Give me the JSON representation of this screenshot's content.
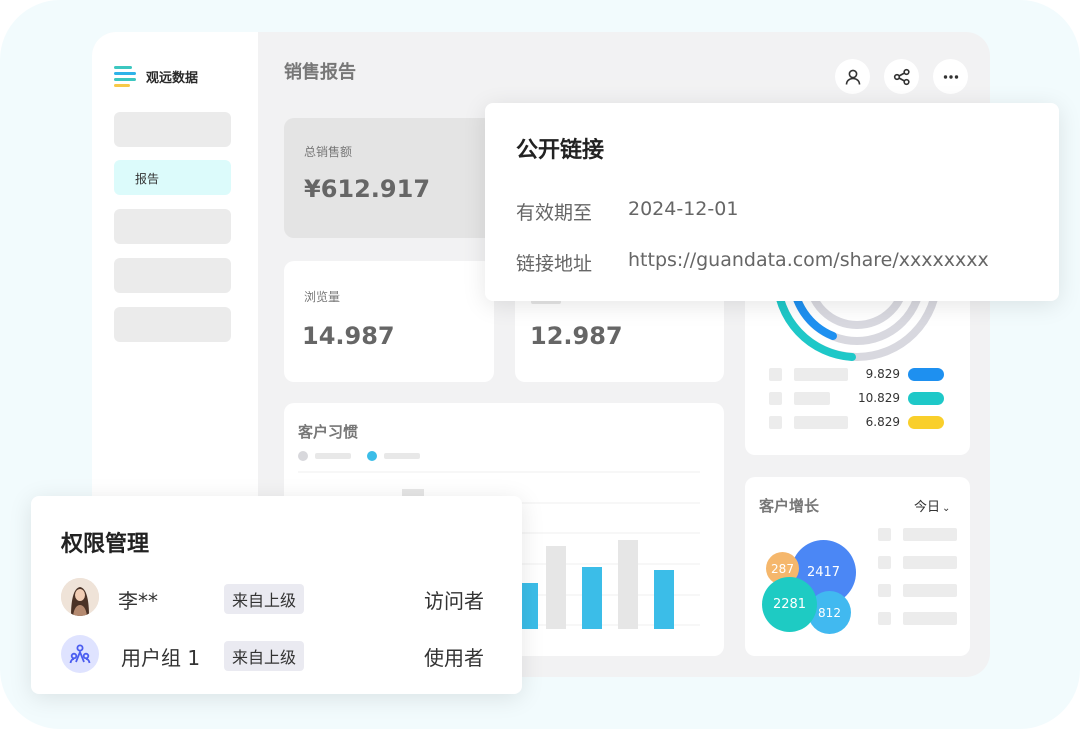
{
  "brand": {
    "name": "观远数据"
  },
  "sidebar": {
    "items": [
      {
        "label": ""
      },
      {
        "label": "报告"
      },
      {
        "label": ""
      },
      {
        "label": ""
      },
      {
        "label": ""
      }
    ]
  },
  "page": {
    "title": "销售报告"
  },
  "toolbar": {
    "icons": [
      "user-icon",
      "share-icon",
      "more-icon"
    ]
  },
  "kpis": {
    "total_sales": {
      "label": "总销售额",
      "value": "¥612.917"
    },
    "views": {
      "label": "浏览量",
      "value": "14.987"
    },
    "second": {
      "value": "12.987"
    }
  },
  "donut_legend": [
    {
      "value": "9.829",
      "color": "#1e90f0"
    },
    {
      "value": "10.829",
      "color": "#1ec8c8"
    },
    {
      "value": "6.829",
      "color": "#f9cf2b"
    }
  ],
  "habit": {
    "title": "客户习惯",
    "series_colors": [
      "#d8d8dc",
      "#3bbde8"
    ]
  },
  "growth": {
    "title": "客户增长",
    "period": "今日",
    "bubbles": [
      "287",
      "2417",
      "2281",
      "812"
    ]
  },
  "share_popup": {
    "title": "公开链接",
    "expiry_label": "有效期至",
    "expiry_value": "2024-12-01",
    "link_label": "链接地址",
    "link_value": "https://guandata.com/share/xxxxxxxx"
  },
  "perm_popup": {
    "title": "权限管理",
    "rows": [
      {
        "name": "李**",
        "tag": "来自上级",
        "role": "访问者"
      },
      {
        "name": "用户组 1",
        "tag": "来自上级",
        "role": "使用者"
      }
    ]
  },
  "colors": {
    "accent": "#3bbde8",
    "teal": "#1ec8c8",
    "blue": "#1e90f0",
    "yellow": "#f9cf2b"
  }
}
